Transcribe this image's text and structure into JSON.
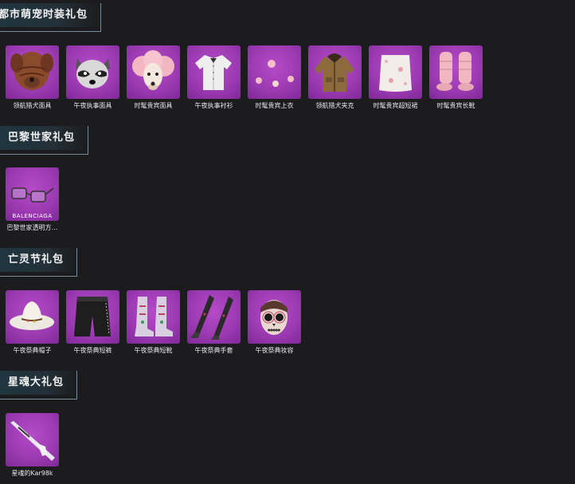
{
  "sections": [
    {
      "title": "都市萌宠时装礼包",
      "items": [
        {
          "label": "领航猎犬面具",
          "icon": "shar-pei-mask-icon"
        },
        {
          "label": "午夜执事面具",
          "icon": "raccoon-mask-icon"
        },
        {
          "label": "时髦贵宾面具",
          "icon": "poodle-mask-icon"
        },
        {
          "label": "午夜执事衬衫",
          "icon": "shirt-icon"
        },
        {
          "label": "时髦贵宾上衣",
          "icon": "pom-pom-top-icon"
        },
        {
          "label": "领航猎犬夹克",
          "icon": "jacket-icon"
        },
        {
          "label": "时髦贵宾超短裙",
          "icon": "fluffy-skirt-icon"
        },
        {
          "label": "时髦贵宾长靴",
          "icon": "fluffy-boots-icon"
        }
      ]
    },
    {
      "title": "巴黎世家礼包",
      "items": [
        {
          "label": "巴黎世家透明方…",
          "icon": "sunglasses-icon",
          "brand": "BALENCIAGA"
        }
      ]
    },
    {
      "title": "亡灵节礼包",
      "items": [
        {
          "label": "午夜祭典帽子",
          "icon": "hat-icon"
        },
        {
          "label": "午夜祭典短裤",
          "icon": "shorts-icon"
        },
        {
          "label": "午夜祭典短靴",
          "icon": "boots-icon"
        },
        {
          "label": "午夜祭典手套",
          "icon": "gloves-icon"
        },
        {
          "label": "午夜祭典妆容",
          "icon": "skull-makeup-icon"
        }
      ]
    },
    {
      "title": "星魂大礼包",
      "items": [
        {
          "label": "星魂的Kar98k",
          "icon": "rifle-icon"
        }
      ]
    }
  ]
}
